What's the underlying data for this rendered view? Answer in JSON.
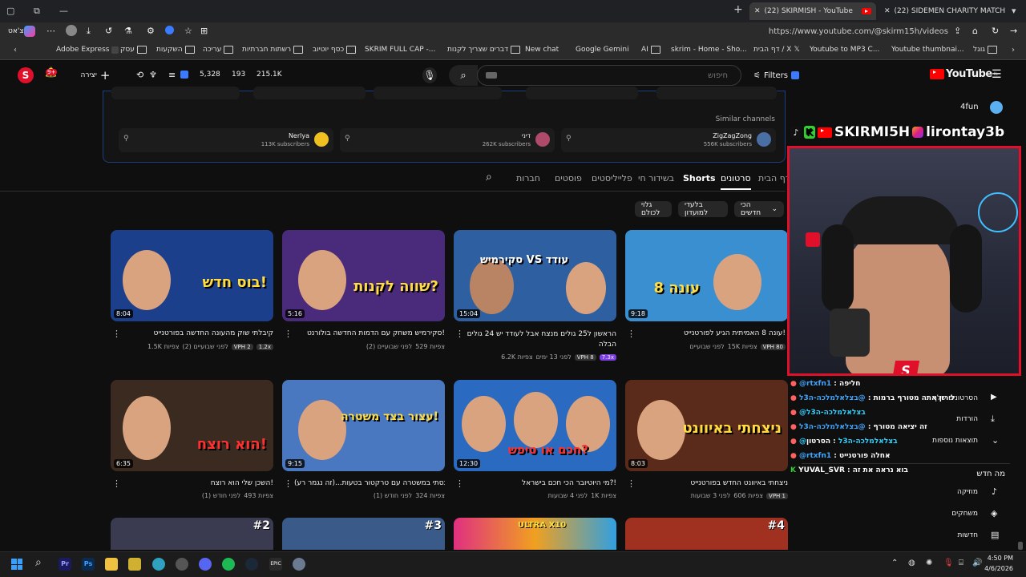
{
  "browser": {
    "tabs": [
      {
        "title": "(22) SKIRMISH - YouTube"
      },
      {
        "title": "(22) SIDEMEN CHARITY MATCH 20"
      }
    ],
    "profile_label": "צ'אט",
    "url": "https://www.youtube.com/@skirm15h/videos",
    "bookmarks": [
      "Adobe Express",
      "עסק",
      "השקעות",
      "עריכה",
      "רשתות חברתיות",
      "כסף יוטיוב",
      "SKRIM FULL CAP -...",
      "דברים שצריך לקנות",
      "New chat",
      "Google Gemini",
      "AI",
      "skrim - Home - Sho...",
      "דף הבית / X",
      "Youtube to MP3 C...",
      "Youtube thumbnai...",
      "גוגל"
    ]
  },
  "header": {
    "create_label": "יצירה",
    "notif_count": "9+",
    "stats": [
      "5,328",
      "193",
      "215.1K"
    ],
    "search_placeholder": "חיפוש",
    "filters_label": "Filters",
    "logo_text": "YouTube",
    "logo_sup": "IL"
  },
  "similar": {
    "heading": "Similar channels",
    "channels": [
      {
        "name": "ZigZagZong",
        "subs": "556K subscribers"
      },
      {
        "name": "דיני",
        "subs": "262K subscribers"
      },
      {
        "name": "Nerlya",
        "subs": "113K subscribers"
      }
    ]
  },
  "nav_tabs": [
    "דף הבית",
    "סרטונים",
    "Shorts",
    "בשידור חי",
    "פלייליסטים",
    "פוסטים",
    "חברות"
  ],
  "chips": [
    "הכי חדשים",
    "בלעדי למועדון",
    "גלוי לכולם"
  ],
  "videos": [
    {
      "duration": "9:18",
      "title": "עונה 8 האמיתית הגיע לפורטנייט!",
      "views": "15K צפיות",
      "age": "לפני שבועיים",
      "badge": "VPH 80",
      "thumb_text": "עונה 8",
      "bg": "#3a8fd0"
    },
    {
      "duration": "15:04",
      "title": "הראשון ל25 גולים מנצח אבל לעודד יש 24 גולים הבלה",
      "views": "6.2K צפיות",
      "age": "לפני 13 ימים",
      "badge": "VPH 8",
      "badge2": "7.3x",
      "thumb_text": "סקירמיש VS עודד",
      "bg": "#2e5fa0"
    },
    {
      "duration": "5:16",
      "title": "סקירמיש משחק עם הדמות החדשה בולורנט!",
      "views": "529 צפיות",
      "age": "לפני שבועיים (2)",
      "badge": "",
      "thumb_text": "שווה לקנות?",
      "bg": "#4a2a7a"
    },
    {
      "duration": "8:04",
      "title": "קיבלתי שוק מהעונה החדשה בפורטנייט",
      "views": "1.5K צפיות",
      "age": "לפני שבועיים (2)",
      "badge": "VPH 2",
      "badge2": "1.2x",
      "thumb_text": "בוס חדש!",
      "bg": "#1c3f8c"
    },
    {
      "duration": "8:03",
      "title": "ניצחתי באיוונט החדש בפורטנייט",
      "views": "606 צפיות",
      "age": "לפני 3 שבועות",
      "badge": "VPH 1",
      "thumb_text": "ניצחתי באיוונט",
      "bg": "#5a2a1a"
    },
    {
      "duration": "12:30",
      "title": "מי היוטיובר הכי חכם בישראל?!",
      "views": "1K צפיות",
      "age": "לפני 4 שבועות",
      "badge": "",
      "thumb_text": "חכם או טיפש?",
      "bg": "#2a6ac0"
    },
    {
      "duration": "9:15",
      "title": "נכנסתי במשטרה עם טרקטור בטעות...(זה נגמר רע)",
      "views": "324 צפיות",
      "age": "לפני חודש (1)",
      "badge": "",
      "thumb_text": "עצור בצד משטרה!",
      "bg": "#4a78c0"
    },
    {
      "duration": "6:35",
      "title": "השכן שלי הוא רוצח!",
      "views": "493 צפיות",
      "age": "לפני חודש (1)",
      "badge": "",
      "thumb_text": "הוא רוצח!",
      "bg": "#3a2a20"
    }
  ],
  "row3_labels": [
    "#4",
    "ULTRA X10",
    "#3",
    "#2"
  ],
  "overlay": {
    "handles": "SKIRMI5H",
    "handle2": "lirontay3b",
    "top_channel": "4fun"
  },
  "chat": [
    {
      "user": "@rtxfn1",
      "msg": "חליפה"
    },
    {
      "user": "@בצלאלמלכה-ה3ל",
      "msg": "לירון אתה מטורף ברמות"
    },
    {
      "user": "@בצלאלמלכה-ה3ל",
      "msg": ""
    },
    {
      "user": "@בצלאלמלכה-ה3ל",
      "msg": "זה יציאה מטורף"
    },
    {
      "user": "@בצלאלמלכה-ה3ל",
      "msg": "הסרטון"
    },
    {
      "user": "@rtxfn1",
      "msg": "אחלה פורטנייט"
    },
    {
      "user": "YUVAL_SVR",
      "msg": "בוא נראה את זה"
    }
  ],
  "sidebar": [
    {
      "label": "הסרטונים שלך"
    },
    {
      "label": "הורדות"
    },
    {
      "label": "תוצאות נוספות"
    },
    {
      "label": "מה חדש"
    },
    {
      "label": "מוזיקה"
    },
    {
      "label": "משחקים"
    },
    {
      "label": "חדשות"
    }
  ],
  "taskbar": {
    "time": "4:50 PM",
    "date": "4/6/2026"
  },
  "colors": {
    "accent": "#ff0000",
    "overlay_border": "#e0102b",
    "link_blue": "#3ea6ff"
  }
}
